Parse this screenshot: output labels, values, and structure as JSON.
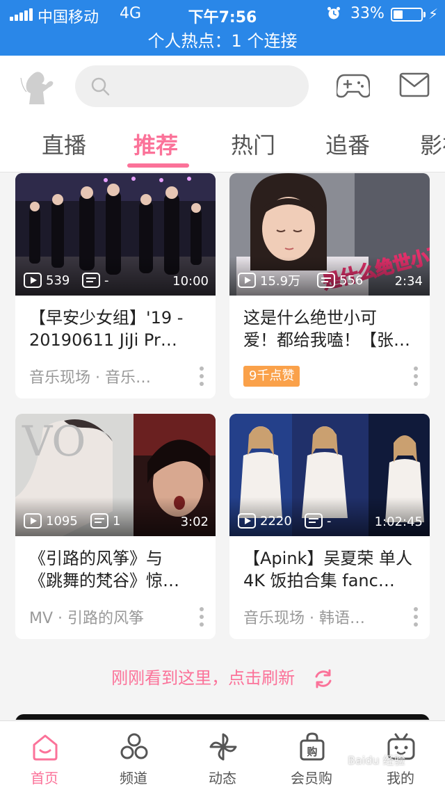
{
  "status_bar": {
    "carrier": "中国移动",
    "network": "4G",
    "time": "下午7:56",
    "battery": "33%",
    "battery_level": 0.33,
    "hotspot": "个人热点：1 个连接"
  },
  "header": {
    "search_placeholder": "",
    "tabs": [
      "直播",
      "推荐",
      "热门",
      "追番",
      "影视"
    ],
    "active_tab": 1
  },
  "colors": {
    "accent": "#fb7299",
    "status_bar": "#2a87e8",
    "like_badge": "#faa14a"
  },
  "feed": {
    "cards": [
      {
        "plays": "539",
        "danmaku": "-",
        "duration": "10:00",
        "title_line1": "【早安少女组】'19 -",
        "title_line2": "20190611  JiJi  Pr…",
        "meta": "音乐现场 · 音乐…",
        "badge": ""
      },
      {
        "plays": "15.9万",
        "danmaku": "556",
        "duration": "2:34",
        "title_line1": "这是什么绝世小可",
        "title_line2": "爱！都给我嗑！【张…",
        "meta": "",
        "badge": "9千点赞"
      },
      {
        "plays": "1095",
        "danmaku": "1",
        "duration": "3:02",
        "title_line1": "《引路的风筝》与",
        "title_line2": "《跳舞的梵谷》惊…",
        "meta": "MV · 引路的风筝",
        "badge": ""
      },
      {
        "plays": "2220",
        "danmaku": "-",
        "duration": "1:02:45",
        "title_line1": "【Apink】吴夏荣  单人",
        "title_line2": "4K  饭拍合集  fanc…",
        "meta": "音乐现场 · 韩语…",
        "badge": ""
      }
    ],
    "refresh_text": "刚刚看到这里，点击刷新"
  },
  "bottom_nav": {
    "items": [
      {
        "label": "首页",
        "icon": "home-icon"
      },
      {
        "label": "频道",
        "icon": "channel-icon"
      },
      {
        "label": "动态",
        "icon": "pinwheel-icon"
      },
      {
        "label": "会员购",
        "icon": "shopping-bag-icon"
      },
      {
        "label": "我的",
        "icon": "tv-icon"
      }
    ],
    "active": 0
  },
  "watermark": "Baidu 经验"
}
